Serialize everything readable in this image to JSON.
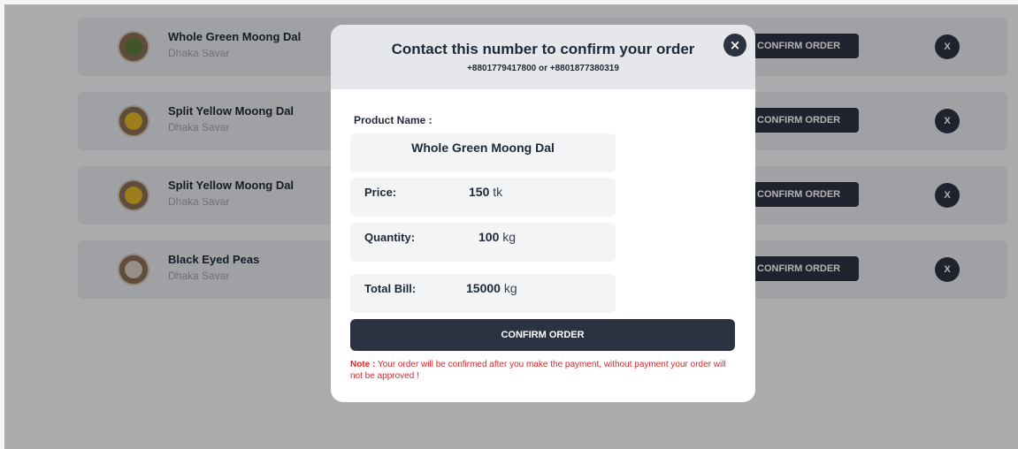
{
  "orders": [
    {
      "name": "Whole Green Moong Dal",
      "location": "Dhaka Savar",
      "confirm_label": "CONFIRM ORDER",
      "delete_label": "X",
      "seed_color": "#5c7a3a"
    },
    {
      "name": "Split Yellow Moong Dal",
      "location": "Dhaka Savar",
      "confirm_label": "CONFIRM ORDER",
      "delete_label": "X",
      "seed_color": "#e0b526"
    },
    {
      "name": "Split Yellow Moong Dal",
      "location": "Dhaka Savar",
      "confirm_label": "CONFIRM ORDER",
      "delete_label": "X",
      "seed_color": "#e0b526"
    },
    {
      "name": "Black Eyed Peas",
      "location": "Dhaka Savar",
      "confirm_label": "CONFIRM ORDER",
      "delete_label": "X",
      "seed_color": "#d8cfc0"
    }
  ],
  "modal": {
    "title": "Contact this number to confirm your order",
    "phones": "+8801779417800 or +8801877380319",
    "close_icon": "×",
    "product_name_label": "Product Name :",
    "product_name": "Whole Green Moong Dal",
    "price_label": "Price:",
    "price_value": "150",
    "price_unit": "tk",
    "quantity_label": "Quantity:",
    "quantity_value": "100",
    "quantity_unit": "kg",
    "total_label": "Total Bill:",
    "total_value": "15000",
    "total_unit": "kg",
    "confirm_label": "CONFIRM ORDER",
    "note_label": "Note :",
    "note_text": "Your order will be confirmed after you make the payment, without payment your order will not be approved !"
  },
  "colors": {
    "dark_button": "#2b3342",
    "note_red": "#dc2626",
    "row_bg": "#e5e7eb"
  }
}
